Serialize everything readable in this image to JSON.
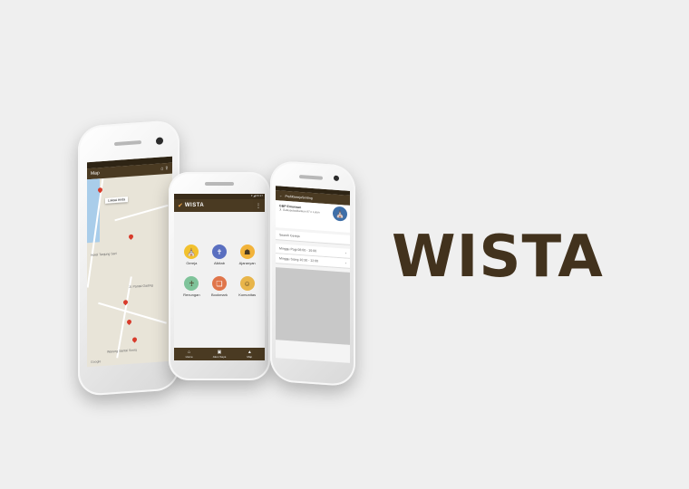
{
  "brand": "WISTA",
  "colors": {
    "primary": "#4a3a22",
    "background": "#efefef"
  },
  "map_phone": {
    "title": "Map",
    "callout": "Lokasi Anda",
    "places": [
      "Hotel Tanjung Sari",
      "Jl. Pantai Gading",
      "Warung Santai Sosiq"
    ],
    "google": "Google"
  },
  "menu_phone": {
    "app_name": "WISTA",
    "status": "▾ ◢ 09:37",
    "menu": [
      {
        "label": "Gereja",
        "icon": "church-icon",
        "color": "#f2c12e",
        "glyph": "⛪"
      },
      {
        "label": "Alkitab",
        "icon": "bible-icon",
        "color": "#5a6fc0",
        "glyph": "✝"
      },
      {
        "label": "Ajaranyan",
        "icon": "teaching-icon",
        "color": "#f2b33a",
        "glyph": "☗"
      },
      {
        "label": "Renungan",
        "icon": "statue-icon",
        "color": "#7fc39a",
        "glyph": "♰"
      },
      {
        "label": "Bookmark",
        "icon": "bookmark-icon",
        "color": "#e0754a",
        "glyph": "❏"
      },
      {
        "label": "Komunitas",
        "icon": "community-icon",
        "color": "#e8b54a",
        "glyph": "☺"
      }
    ],
    "nav": [
      {
        "label": "Home",
        "icon": "home-icon",
        "glyph": "⌂"
      },
      {
        "label": "Akun Saya",
        "icon": "account-icon",
        "glyph": "▣"
      },
      {
        "label": "Map",
        "icon": "map-icon",
        "glyph": "▲"
      }
    ]
  },
  "detail_phone": {
    "title": "ProfilGerejaSmiting",
    "church_name": "GBP Emunaan",
    "church_address": "Jl. Gatkasebadilankan 97 n Lutan",
    "search_placeholder": "Search Gereja",
    "schedules": [
      "Minggu Pagi 08:00 - 10:00",
      "Minggu Siang 10:30 - 12:00"
    ]
  }
}
